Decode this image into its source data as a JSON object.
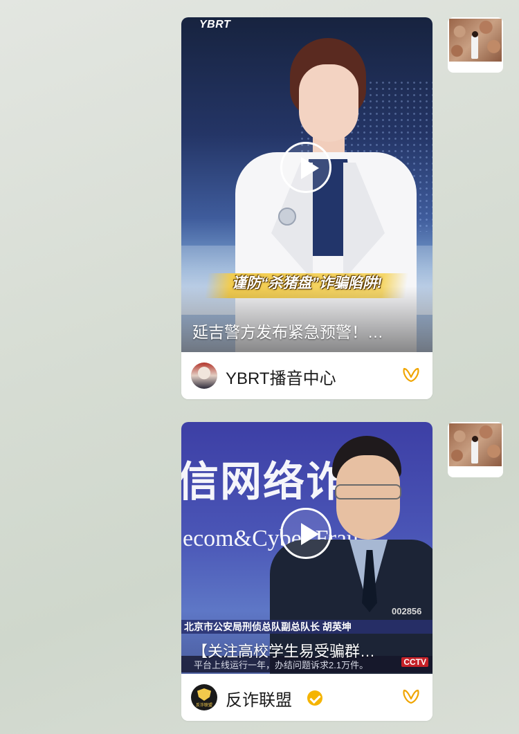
{
  "feed": [
    {
      "video_overlay_logo": "YBRT",
      "slogan": "谨防“杀猪盘”诈骗陷阱!",
      "caption": "延吉警方发布紧急预警！…",
      "channel_name": "YBRT播音中心",
      "verified": false
    },
    {
      "background_text_cn": "信网络诈",
      "background_text_en": "ecom&Cyber Frau",
      "lower_third": "北京市公安局刑侦总队副总队长  胡英坤",
      "badge_number": "002856",
      "ticker": "平台上线运行一年，办结问题诉求2.1万件。",
      "ticker_logo": "CCTV",
      "caption": "【关注高校学生易受骗群…",
      "channel_name": "反诈联盟",
      "avatar_text": "反诈联盟",
      "verified": true
    }
  ],
  "colors": {
    "accent": "#f5b400",
    "channel_icon": "#f0a500"
  },
  "icons": {
    "play": "play-icon",
    "channel": "wechat-channels-icon",
    "verified": "verified-badge-icon"
  }
}
